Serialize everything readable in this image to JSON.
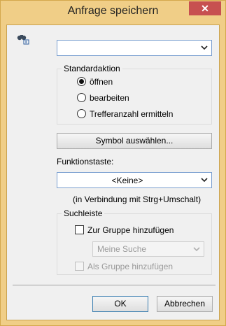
{
  "window": {
    "title": "Anfrage speichern",
    "close_glyph": "✕",
    "accent_color": "#f0ce87",
    "close_color": "#c75050"
  },
  "name_combo": {
    "value": ""
  },
  "standard_action": {
    "label": "Standardaktion",
    "options": [
      {
        "label": "öffnen",
        "checked": true
      },
      {
        "label": "bearbeiten",
        "checked": false
      },
      {
        "label": "Trefferanzahl ermitteln",
        "checked": false
      }
    ]
  },
  "symbol_button": {
    "label": "Symbol auswählen..."
  },
  "function_key": {
    "label": "Funktionstaste:",
    "value": "<Keine>",
    "hint": "(in Verbindung mit Strg+Umschalt)"
  },
  "search_bar": {
    "label": "Suchleiste",
    "add_to_group": {
      "label": "Zur Gruppe hinzufügen",
      "checked": false
    },
    "group_combo": {
      "value": "Meine Suche"
    },
    "add_as_group": {
      "label": "Als Gruppe hinzufügen",
      "checked": false
    }
  },
  "buttons": {
    "ok": "OK",
    "cancel": "Abbrechen"
  },
  "icons": {
    "library": "binoculars-library-icon",
    "dropdown": "chevron-down-icon"
  }
}
